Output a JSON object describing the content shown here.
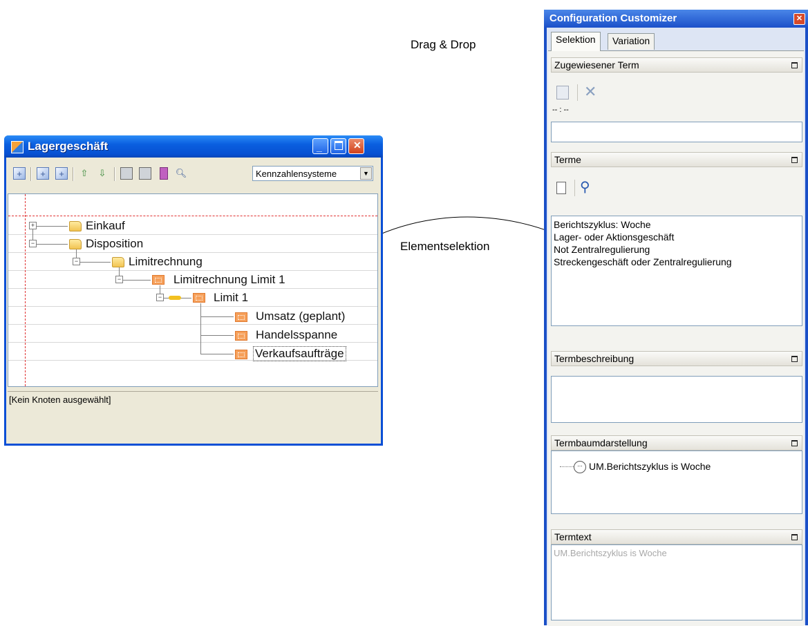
{
  "annotations": {
    "drag_drop": "Drag & Drop",
    "element_selection": "Elementselektion"
  },
  "left_window": {
    "title": "Lagergeschäft",
    "controls": [
      "minimize-icon",
      "maximize-icon",
      "close-icon"
    ],
    "toolbar_icons": [
      "add-sibling-icon",
      "add-child-icon",
      "add-node-icon",
      "move-up-icon",
      "move-down-icon",
      "print-icon",
      "print-settings-icon",
      "book-icon",
      "preview-icon"
    ],
    "combo_value": "Kennzahlensysteme",
    "tree": [
      {
        "label": "Einkauf",
        "level": 0,
        "icon": "folder-icon",
        "expander": "+"
      },
      {
        "label": "Disposition",
        "level": 0,
        "icon": "folder-icon",
        "expander": "-"
      },
      {
        "label": "Limitrechnung",
        "level": 1,
        "icon": "folder-icon",
        "expander": "-"
      },
      {
        "label": "Limitrechnung Limit 1",
        "level": 2,
        "icon": "node-icon",
        "expander": "-"
      },
      {
        "label": "Limit 1",
        "level": 3,
        "icon": "node-icon",
        "expander": "-"
      },
      {
        "label": "Umsatz (geplant)",
        "level": 4,
        "icon": "node-icon"
      },
      {
        "label": "Handelsspanne",
        "level": 4,
        "icon": "node-icon"
      },
      {
        "label": "Verkaufsaufträge",
        "level": 4,
        "icon": "node-icon",
        "selected": true
      }
    ],
    "status": "[Kein Knoten ausgewählt]"
  },
  "right_panel": {
    "title": "Configuration Customizer",
    "tabs": [
      "Selektion",
      "Variation"
    ],
    "active_tab": "Selektion",
    "sections": {
      "assigned_term": {
        "header": "Zugewiesener Term",
        "value": "-- : --",
        "input": ""
      },
      "terms": {
        "header": "Terme",
        "items": [
          "Berichtszyklus: Woche",
          "Lager- oder Aktionsgeschäft",
          "Not Zentralregulierung",
          "Streckengeschäft oder Zentralregulierung"
        ]
      },
      "description": {
        "header": "Termbeschreibung"
      },
      "tree_view": {
        "header": "Termbaumdarstellung",
        "node_label": "UM.Berichtszyklus is Woche"
      },
      "term_text": {
        "header": "Termtext",
        "text": "UM.Berichtszyklus is Woche"
      }
    }
  },
  "colors": {
    "xp_blue": "#0a5fe0",
    "tree_guide_red": "#e03030",
    "node_orange": "#f6a05a",
    "folder_yellow": "#f2c452"
  }
}
